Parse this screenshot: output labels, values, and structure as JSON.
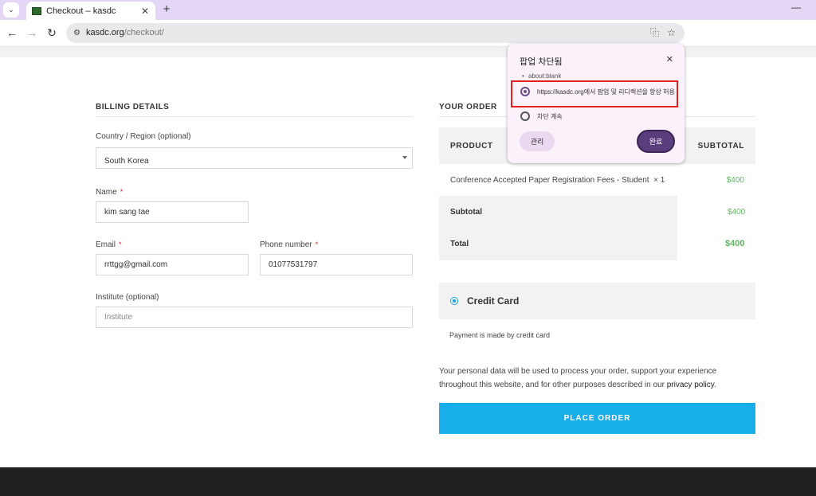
{
  "browser": {
    "tab_title": "Checkout – kasdc",
    "url_domain": "kasdc.org",
    "url_path": "/checkout/"
  },
  "billing": {
    "title": "BILLING DETAILS",
    "country_label": "Country / Region (optional)",
    "country_value": "South Korea",
    "name_label": "Name",
    "name_value": "kim sang tae",
    "email_label": "Email",
    "email_value": "rrttgg@gmail.com",
    "phone_label": "Phone number",
    "phone_value": "01077531797",
    "institute_label": "Institute (optional)",
    "institute_placeholder": "Institute",
    "required_mark": "*"
  },
  "order": {
    "title": "YOUR ORDER",
    "col_product": "PRODUCT",
    "col_subtotal": "SUBTOTAL",
    "item_name": "Conference Accepted Paper Registration Fees - Student",
    "item_qty": "× 1",
    "item_price": "$400",
    "subtotal_label": "Subtotal",
    "subtotal_value": "$400",
    "total_label": "Total",
    "total_value": "$400"
  },
  "payment": {
    "method": "Credit Card",
    "description": "Payment is made by credit card",
    "privacy_text": "Your personal data will be used to process your order, support your experience throughout this website, and for other purposes described in our ",
    "privacy_link": "privacy policy",
    "privacy_end": ".",
    "place_order": "PLACE ORDER"
  },
  "popup": {
    "title": "팝업 차단됨",
    "blocked_link": "about:blank",
    "option_allow": "https://kasdc.org에서 팝업 및 리디렉션을 항상 허용",
    "option_block": "차단 계속",
    "manage_label": "관리",
    "done_label": "완료"
  }
}
